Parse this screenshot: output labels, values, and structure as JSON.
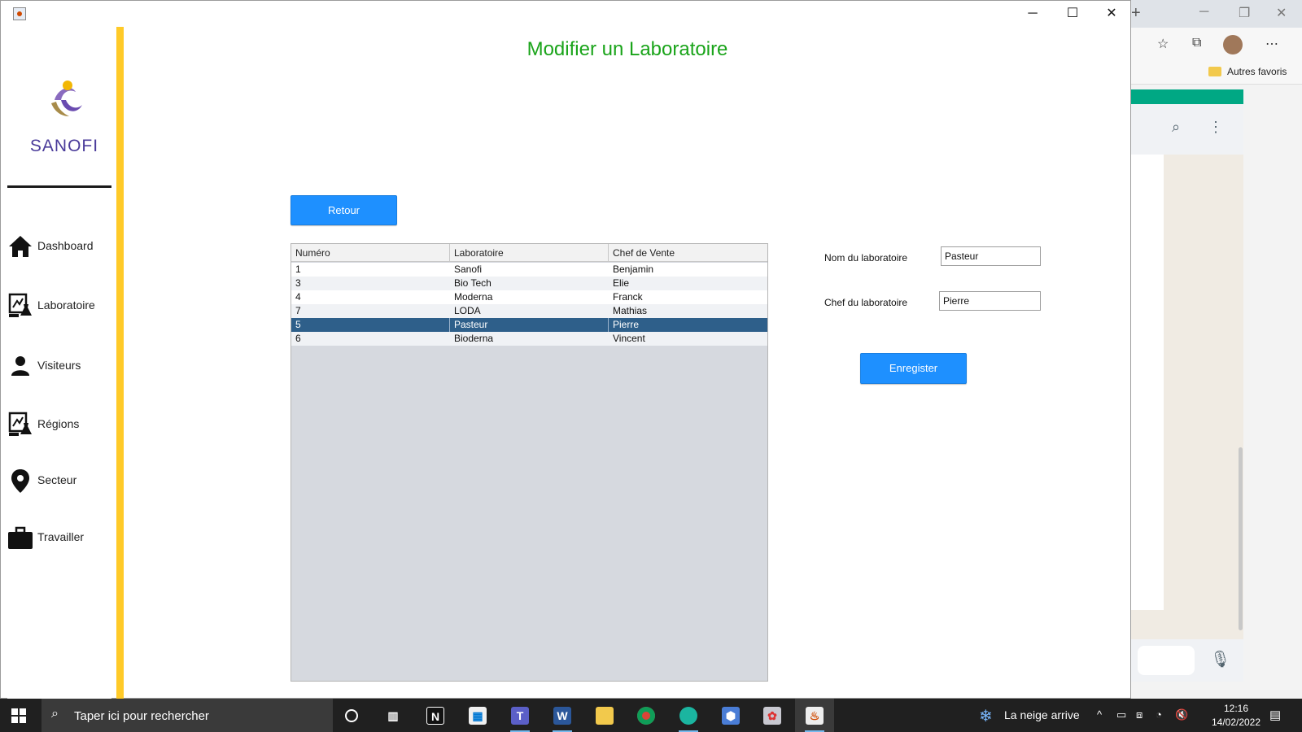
{
  "window": {
    "title": "Modifier un Laboratoire",
    "minimize": "─",
    "maximize": "☐",
    "close": "✕"
  },
  "sidebar": {
    "logo_text": "SANOFI",
    "items": [
      {
        "label": "Dashboard",
        "icon": "home-icon"
      },
      {
        "label": "Laboratoire",
        "icon": "lab-icon"
      },
      {
        "label": "Visiteurs",
        "icon": "person-icon"
      },
      {
        "label": "Régions",
        "icon": "lab-icon"
      },
      {
        "label": "Secteur",
        "icon": "map-pin-icon"
      },
      {
        "label": "Travailler",
        "icon": "briefcase-icon"
      }
    ]
  },
  "main": {
    "back_button": "Retour",
    "table": {
      "columns": [
        "Numéro",
        "Laboratoire",
        "Chef de Vente"
      ],
      "rows": [
        [
          "1",
          "Sanofi",
          "Benjamin"
        ],
        [
          "3",
          "Bio Tech",
          "Elie"
        ],
        [
          "4",
          "Moderna",
          "Franck"
        ],
        [
          "7",
          "LODA",
          "Mathias"
        ],
        [
          "5",
          "Pasteur",
          "Pierre"
        ],
        [
          "6",
          "Bioderna",
          "Vincent"
        ]
      ],
      "selected_row": 4
    },
    "form": {
      "name_label": "Nom du laboratoire",
      "name_value": "Pasteur",
      "chef_label": "Chef du laboratoire",
      "chef_value": "Pierre",
      "save_button": "Enregister"
    }
  },
  "browser": {
    "favorites_label": "Autres favoris"
  },
  "taskbar": {
    "search_placeholder": "Taper ici pour rechercher",
    "weather": "La neige arrive",
    "time": "12:16",
    "date": "14/02/2022"
  },
  "colors": {
    "title_green": "#1aa41a",
    "button_blue": "#1e90ff",
    "sidebar_accent": "#ffca28",
    "selected_row": "#2e5f8a"
  }
}
